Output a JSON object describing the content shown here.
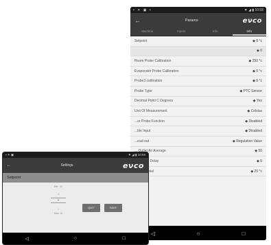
{
  "big_screen": {
    "status_left": [
      "▪",
      "✦",
      "▣",
      "▪"
    ],
    "status_right": "▼ ◢ ▮ 10:58",
    "back_label": "←",
    "title": "Params",
    "logo": "eνco",
    "tabs": [
      "Machine",
      "Inputs",
      "Info",
      "Info"
    ],
    "rows": [
      {
        "label": "Setpoint",
        "value": "◆ 0 °c"
      },
      {
        "label": "",
        "value": "◆ 0"
      },
      {
        "label": "Room Probe Calibration",
        "value": "◆ 250 °c"
      },
      {
        "label": "Evaporator Probe Calibration",
        "value": "◆ 0 °c"
      },
      {
        "label": "Probe3 calibration",
        "value": "◆ 0 °c"
      },
      {
        "label": "Probe Type",
        "value": "◆ PTC Sensor"
      },
      {
        "label": "Decimal Point C Degrees",
        "value": "◆ Yes"
      },
      {
        "label": "Unit Of Measurement",
        "value": "◆ Celsius"
      },
      {
        "label": "...or Probe Function",
        "value": "◆ Disabled"
      },
      {
        "label": "...ble Input",
        "value": "◆ Disabled"
      },
      {
        "label": "...ead-out",
        "value": "◆ Regulation Value"
      },
      {
        "label": "... Outlet Air Average",
        "value": "◆ 50"
      },
      {
        "label": "...ead-out Delay",
        "value": "◆ 5"
      },
      {
        "label": "...Differential",
        "value": "◆ 20 °c"
      }
    ],
    "nav": {
      "back": "◁",
      "home": "○",
      "recent": "□"
    }
  },
  "small_screen": {
    "status_left": "▪ ✦ ▣",
    "status_right": "▼ ◢ ▮ 10:59",
    "back_label": "←",
    "title": "Settings",
    "logo": "eνco",
    "header": "Setpoint",
    "picker": {
      "range": "Min: -10",
      "above": "-1",
      "current": "0",
      "below": "1",
      "max": "Max: 10"
    },
    "btn_left": "QUIT",
    "btn_right": "SAVE",
    "nav": {
      "back": "◁",
      "home": "○",
      "recent": "□"
    }
  }
}
